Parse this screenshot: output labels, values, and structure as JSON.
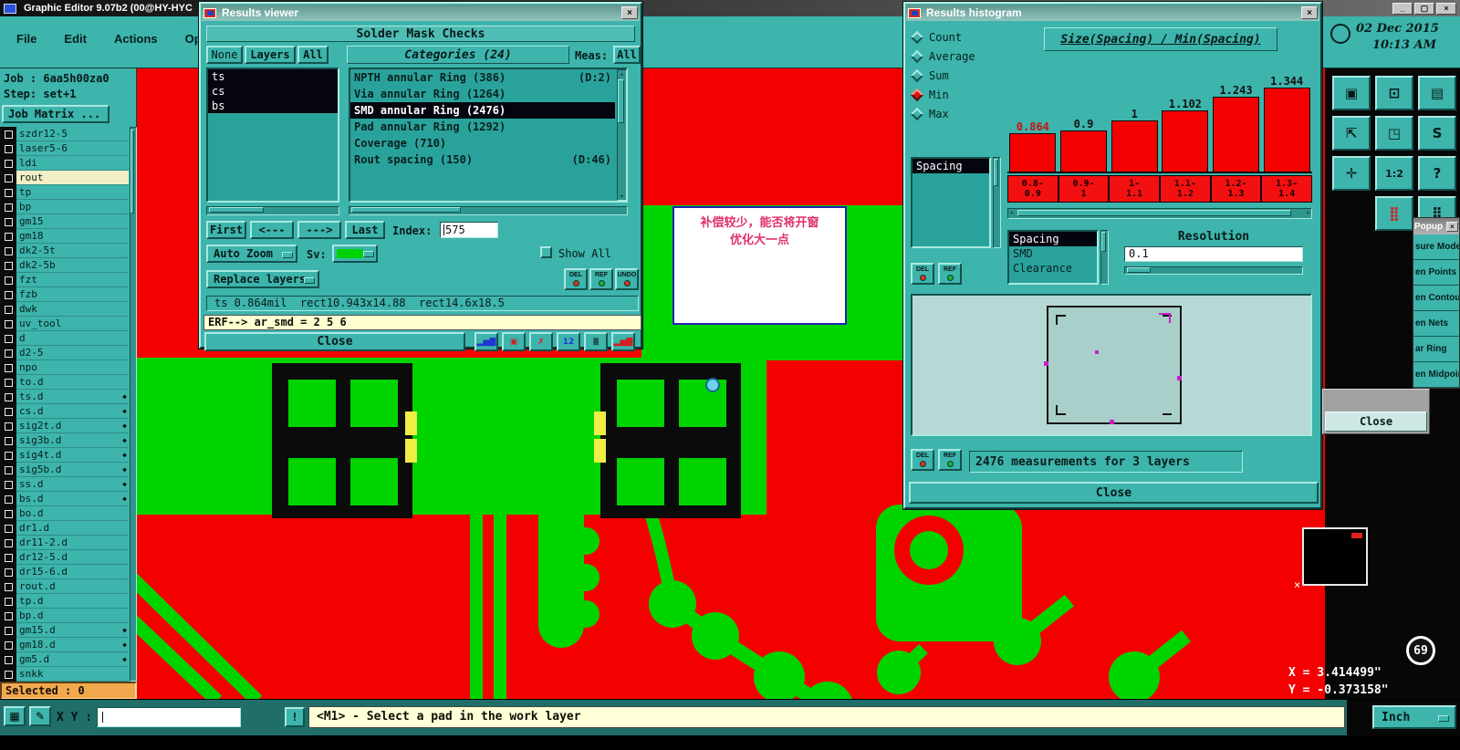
{
  "window": {
    "title": "Graphic Editor 9.07b2 (00@HY-HYC",
    "controls": [
      {
        "name": "minimize",
        "glyph": "_"
      },
      {
        "name": "maximize",
        "glyph": "▢"
      },
      {
        "name": "close",
        "glyph": "×"
      }
    ]
  },
  "menubar": {
    "items": [
      "File",
      "Edit",
      "Actions",
      "Options"
    ]
  },
  "clock": {
    "date": "02 Dec 2015",
    "time": "10:13 AM"
  },
  "job_panel": {
    "job_label": "Job : 6aa5h00za0",
    "step_label": "Step: set+1",
    "matrix_button": "Job Matrix ...",
    "selected_label": "Selected : 0",
    "layers": [
      {
        "name": "szdr12-5"
      },
      {
        "name": "laser5-6"
      },
      {
        "name": "ldi"
      },
      {
        "name": "rout",
        "hl": true
      },
      {
        "name": "tp"
      },
      {
        "name": "bp"
      },
      {
        "name": "gm15"
      },
      {
        "name": "gm18"
      },
      {
        "name": "dk2-5t"
      },
      {
        "name": "dk2-5b"
      },
      {
        "name": "fzt"
      },
      {
        "name": "fzb"
      },
      {
        "name": "dwk"
      },
      {
        "name": "uv_tool"
      },
      {
        "name": "d"
      },
      {
        "name": "d2-5"
      },
      {
        "name": "npo"
      },
      {
        "name": "to.d"
      },
      {
        "name": "ts.d",
        "flag": true
      },
      {
        "name": "cs.d",
        "flag": true
      },
      {
        "name": "sig2t.d",
        "flag": true
      },
      {
        "name": "sig3b.d",
        "flag": true
      },
      {
        "name": "sig4t.d",
        "flag": true
      },
      {
        "name": "sig5b.d",
        "flag": true
      },
      {
        "name": "ss.d",
        "flag": true
      },
      {
        "name": "bs.d",
        "flag": true
      },
      {
        "name": "bo.d"
      },
      {
        "name": "dr1.d"
      },
      {
        "name": "dr11-2.d"
      },
      {
        "name": "dr12-5.d"
      },
      {
        "name": "dr15-6.d"
      },
      {
        "name": "rout.d"
      },
      {
        "name": "tp.d"
      },
      {
        "name": "bp.d"
      },
      {
        "name": "gm15.d",
        "flag": true
      },
      {
        "name": "gm18.d",
        "flag": true
      },
      {
        "name": "gm5.d",
        "flag": true
      },
      {
        "name": "snkk"
      }
    ]
  },
  "results_viewer": {
    "title": "Results viewer",
    "header": "Solder Mask Checks",
    "filter_none": "None",
    "filter_layers": "Layers",
    "filter_all": "All",
    "categories_header": "Categories (24)",
    "meas_label": "Meas:",
    "meas_value": "All",
    "layers": [
      {
        "name": "ts",
        "selected": true
      },
      {
        "name": "cs",
        "selected": true
      },
      {
        "name": "bs",
        "selected": true
      }
    ],
    "categories": [
      {
        "label": "NPTH annular Ring (386)",
        "extra": "(D:2)"
      },
      {
        "label": "Via annular Ring (1264)",
        "extra": ""
      },
      {
        "label": "SMD annular Ring (2476)",
        "extra": "",
        "selected": true
      },
      {
        "label": "Pad annular Ring (1292)",
        "extra": ""
      },
      {
        "label": "Coverage (710)",
        "extra": ""
      },
      {
        "label": "Rout spacing (150)",
        "extra": "(D:46)"
      }
    ],
    "nav_first": "First",
    "nav_prev": "<---",
    "nav_next": "--->",
    "nav_last": "Last",
    "index_label": "Index:",
    "index_value": "575",
    "auto_zoom": "Auto Zoom",
    "sv_label": "Sv:",
    "sv_color": "#00d400",
    "show_all": "Show All",
    "replace_layers": "Replace layers",
    "action_buttons": [
      {
        "label": "DEL",
        "dot": "#e03020"
      },
      {
        "label": "REF",
        "dot": "#20b030"
      },
      {
        "label": "UNDO",
        "dot": "#e03020"
      }
    ],
    "status_line": "ts 0.864mil  rect10.943x14.88  rect14.6x18.5",
    "erf_line": "ERF--> ar_smd = 2 5 6",
    "close_button": "Close",
    "icons": [
      {
        "name": "histogram-rgb-icon",
        "glyph": "▂▅▇",
        "color": "#2038d0"
      },
      {
        "name": "capture-icon",
        "glyph": "▣",
        "color": "#d02020"
      },
      {
        "name": "discard-icon",
        "glyph": "✗",
        "color": "#d02020"
      },
      {
        "name": "meas12-icon",
        "glyph": "12",
        "color": "#2038d0"
      },
      {
        "name": "report-icon",
        "glyph": "≣",
        "color": "#101010"
      },
      {
        "name": "histogram-red-icon",
        "glyph": "▂▅▇",
        "color": "#d02020"
      }
    ]
  },
  "results_histogram": {
    "title": "Results histogram",
    "stats": [
      {
        "label": "Count"
      },
      {
        "label": "Average"
      },
      {
        "label": "Sum"
      },
      {
        "label": "Min",
        "selected": true
      },
      {
        "label": "Max"
      }
    ],
    "measure_list": [
      {
        "label": "Spacing",
        "selected": true
      }
    ],
    "action_buttons": [
      {
        "label": "DEL",
        "dot": "#e03020"
      },
      {
        "label": "REF",
        "dot": "#20b030"
      }
    ],
    "header": "Size(Spacing) /  Min(Spacing)",
    "series_list": [
      {
        "label": "Spacing",
        "selected": true
      },
      {
        "label": "SMD"
      },
      {
        "label": "Clearance"
      }
    ],
    "resolution_label": "Resolution",
    "resolution_value": "0.1",
    "footer_text": "2476 measurements for 3 layers",
    "footer_icons": [
      {
        "name": "export-blue-icon",
        "glyph": "◲",
        "color": "#2038d0"
      },
      {
        "name": "export-red-icon",
        "glyph": "◱",
        "color": "#d02020"
      }
    ],
    "close_button": "Close"
  },
  "chart_data": {
    "type": "bar",
    "title": "Size(Spacing) / Min(Spacing)",
    "categories": [
      "0.8-0.9",
      "0.9-1",
      "1-1.1",
      "1.1-1.2",
      "1.2-1.3",
      "1.3-1.4"
    ],
    "values": [
      0.864,
      0.9,
      1,
      1.102,
      1.243,
      1.344
    ],
    "bar_labels": [
      "0.864",
      "0.9",
      "1",
      "1.102",
      "1.243",
      "1.344"
    ],
    "bin_labels": [
      [
        "0.8-",
        "0.9"
      ],
      [
        "0.9-",
        "1"
      ],
      [
        "1-",
        "1.1"
      ],
      [
        "1.1-",
        "1.2"
      ],
      [
        "1.2-",
        "1.3"
      ],
      [
        "1.3-",
        "1.4"
      ]
    ],
    "bar_color": "#f40000",
    "label_colors": [
      "#cc1010",
      "#111111",
      "#111111",
      "#111111",
      "#111111",
      "#111111"
    ],
    "xlabel": "",
    "ylabel": "",
    "ylim": [
      0,
      1.5
    ],
    "grid": false,
    "legend_position": "none"
  },
  "popup": {
    "title": "Popup",
    "items": [
      "sure Mode",
      "en Points",
      "en Contours",
      "en Nets",
      "ar Ring",
      "en Midpoints"
    ],
    "close_button": "Close"
  },
  "right_toolbar": {
    "icons": [
      {
        "name": "display-icon",
        "glyph": "▣"
      },
      {
        "name": "lock-icon",
        "glyph": "⊡"
      },
      {
        "name": "layers-icon",
        "glyph": "▤"
      },
      {
        "name": "export-icon",
        "glyph": "⇱"
      },
      {
        "name": "window-icon",
        "glyph": "◳"
      },
      {
        "name": "snap-icon",
        "glyph": "S"
      },
      {
        "name": "pan-icon",
        "glyph": "✛"
      },
      {
        "name": "scale-1-2-icon",
        "glyph": "1:2"
      },
      {
        "name": "help-icon",
        "glyph": "?"
      },
      null,
      {
        "name": "highlight-icon",
        "glyph": "⣿",
        "color": "#d02020"
      },
      {
        "name": "dots-icon",
        "glyph": "⣿"
      }
    ]
  },
  "status_bar": {
    "icons": [
      {
        "name": "grid-toggle-icon",
        "glyph": "▦"
      },
      {
        "name": "edit-note-icon",
        "glyph": "✎"
      }
    ],
    "xy_label": "X Y :",
    "alert_button": "!",
    "message": "<M1> - Select a pad in the work layer",
    "units": "Inch"
  },
  "readout": {
    "x": "X = 3.414499\"",
    "y": "Y = -0.373158\"",
    "badge": "69"
  },
  "annotation": {
    "line1": "补偿较少，能否将开窗",
    "line2": "优化大一点"
  }
}
